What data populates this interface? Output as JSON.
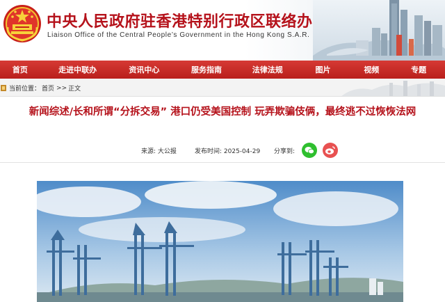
{
  "header": {
    "title_cn": "中央人民政府驻香港特别行政区联络办公室",
    "title_en": "Liaison Office of the Central People’s Government in the Hong Kong S.A.R."
  },
  "nav": {
    "items": [
      {
        "label": "首页"
      },
      {
        "label": "走进中联办"
      },
      {
        "label": "资讯中心"
      },
      {
        "label": "服务指南"
      },
      {
        "label": "法律法规"
      },
      {
        "label": "图片"
      },
      {
        "label": "视频"
      },
      {
        "label": "专题"
      }
    ]
  },
  "breadcrumb": {
    "prefix": "当前位置：",
    "home": "首页",
    "sep": ">>",
    "current": "正文"
  },
  "article": {
    "headline": "新闻综述/长和所谓“分拆交易” 港口仍受美国控制 玩弄欺骗伎俩，最终逃不过恢恢法网",
    "source": "来源: 大公报",
    "date_label": "发布时间: 2025-04-29",
    "share_label": "分享到:"
  },
  "icons": {
    "home": "home-icon",
    "wechat": "wechat-icon",
    "weibo": "weibo-icon",
    "emblem": "national-emblem-icon"
  },
  "colors": {
    "brand_red": "#b5121b",
    "nav_red": "#c8282a",
    "wechat_green": "#2fbf2f",
    "weibo_red": "#e85151"
  }
}
